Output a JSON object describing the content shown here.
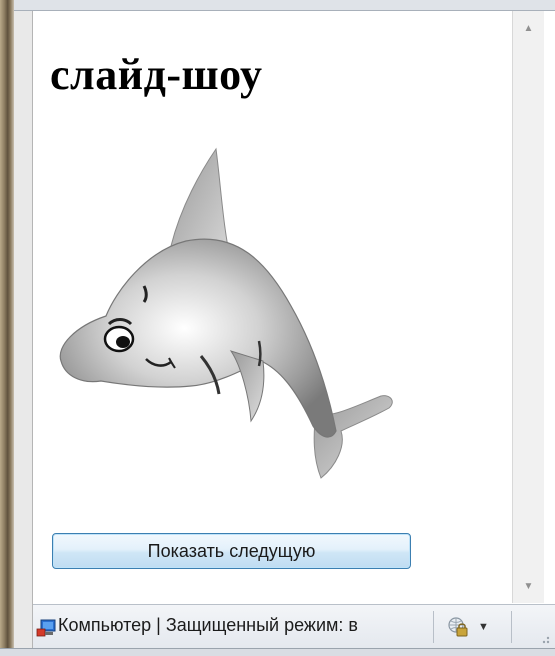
{
  "page": {
    "title": "слайд-шоу",
    "next_button_label": "Показать следущую"
  },
  "image": {
    "subject": "dolphin"
  },
  "statusbar": {
    "text": "Компьютер | Защищенный режим: в"
  },
  "icons": {
    "status_zone": "computer-icon",
    "protected_mode": "globe-lock-icon",
    "dropdown": "chevron-down-icon",
    "scroll_up": "arrow-up-icon",
    "scroll_down": "arrow-down-icon"
  }
}
